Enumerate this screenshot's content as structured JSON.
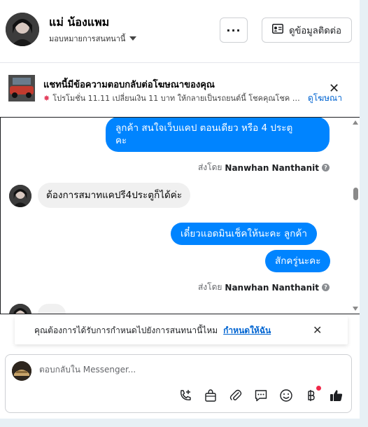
{
  "header": {
    "name": "แม่ น้องแพม",
    "assign_label": "มอบหมายการสนทนานี้",
    "more_label": "···",
    "contact_label": "ดูข้อมูลติดต่อ"
  },
  "ad_banner": {
    "title": "แชทนี้มีข้อความตอบกลับต่อโฆษณาของคุณ",
    "subtitle": "โปรโมชั่น 11.11 เปลี่ยนเงิน 11 บาท ให้กลายเป็นรถยนต์นี้ โชคคุณโชค จั...",
    "link_label": "ดูโฆษณา",
    "close_label": "✕"
  },
  "messages": [
    {
      "direction": "out",
      "text": "ลูกค้า สนใจเว็บแคป  ตอนเดียว หรือ 4 ประตู\nคะ"
    },
    {
      "direction": "sent_by",
      "prefix": "ส่งโดย",
      "name": "Nanwhan Nanthanit"
    },
    {
      "direction": "in",
      "text": "ต้องการสมาทแคปรี4ประตูก็ได้ค่ะ"
    },
    {
      "direction": "out",
      "text": "เดี๋ยวแอดมินเช็คให้นะคะ  ลูกค้า"
    },
    {
      "direction": "out",
      "text": "สักครู่นะคะ"
    },
    {
      "direction": "sent_by",
      "prefix": "ส่งโดย",
      "name": "Nanwhan Nanthanit"
    }
  ],
  "prompt": {
    "text": "คุณต้องการได้รับการกำหนดไปยังการสนทนานี้ไหม",
    "link_label": "กำหนดให้ฉัน",
    "close_label": "✕"
  },
  "composer": {
    "placeholder": "ตอบกลับใน Messenger...",
    "tools": [
      "phone-plus-icon",
      "shopping-bag-icon",
      "paperclip-icon",
      "chat-bubble-icon",
      "emoji-icon",
      "baht-icon",
      "thumbs-up-icon"
    ]
  },
  "colors": {
    "brand_blue": "#0084ff",
    "link_blue": "#0064d1",
    "notification_red": "#f02849"
  }
}
